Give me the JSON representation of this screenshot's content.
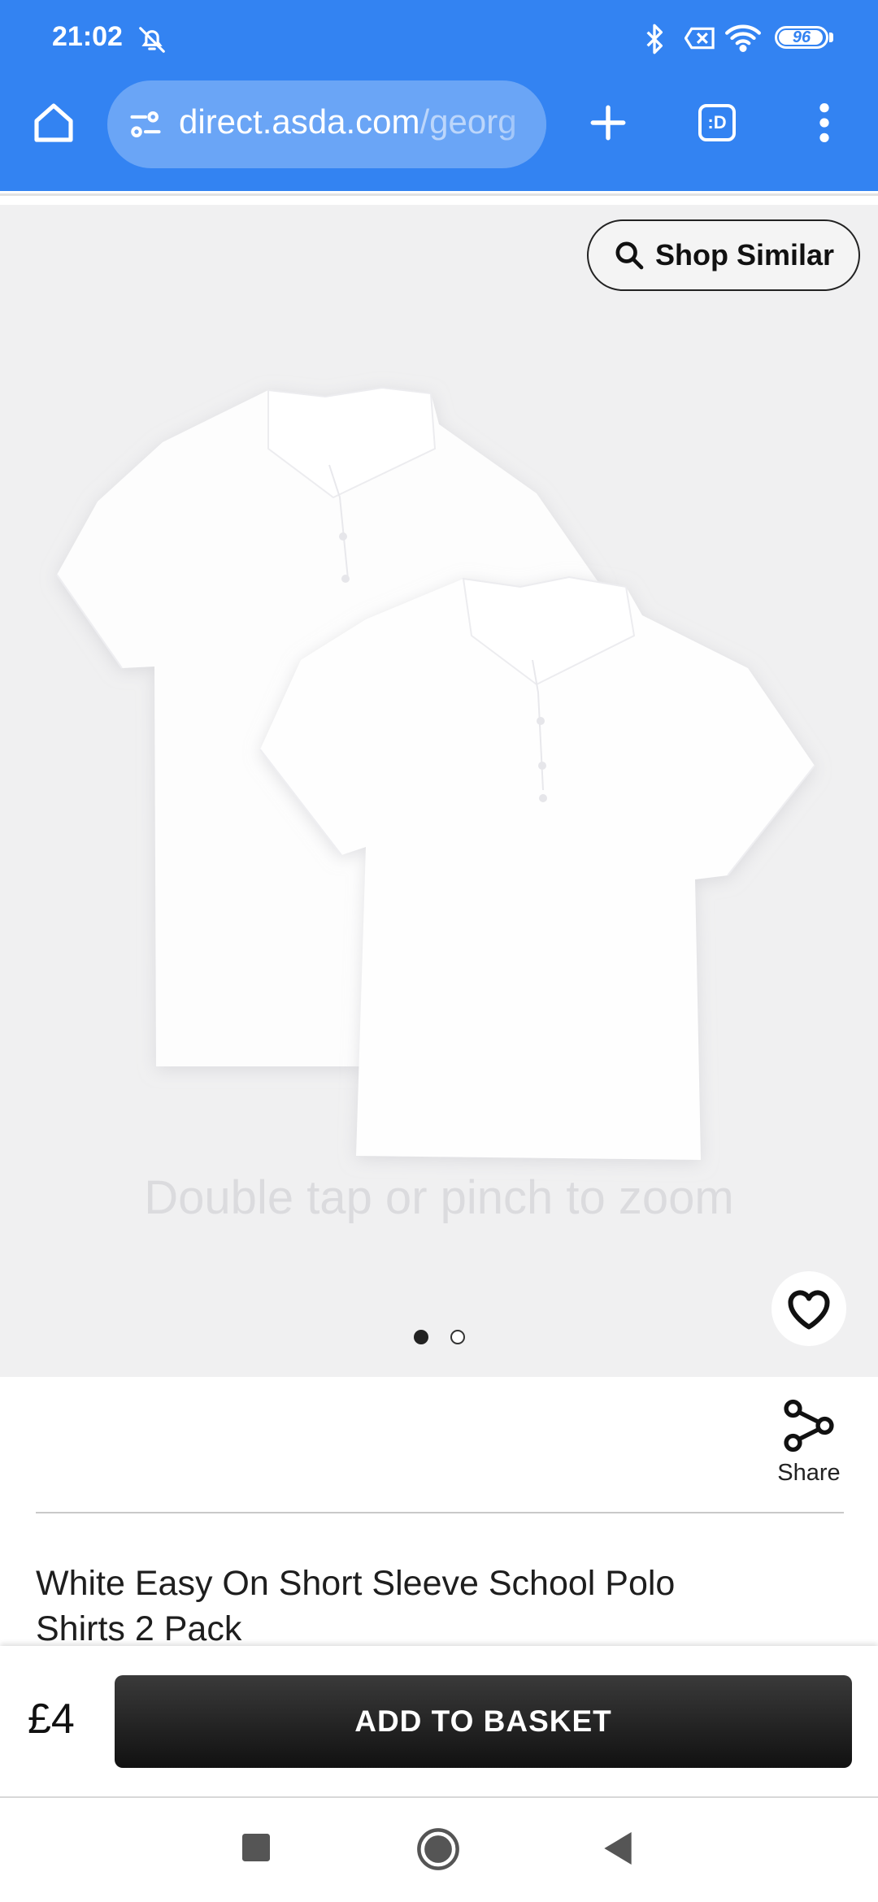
{
  "status_bar": {
    "time": "21:02",
    "battery_level": "96",
    "battery_fraction": 0.96,
    "icons": [
      "alarm-off-icon",
      "bluetooth-icon",
      "sim-disabled-icon",
      "wifi-icon",
      "battery-icon"
    ]
  },
  "browser": {
    "url_host": "direct.asda.com",
    "url_path": "/georg",
    "icons": [
      "home-icon",
      "site-settings-icon",
      "new-tab-icon",
      "tab-switcher-icon",
      "more-vert-icon"
    ],
    "tab_switcher_label": ":D",
    "theme_color": "#3383f2"
  },
  "gallery": {
    "shop_similar_label": "Shop Similar",
    "zoom_hint": "Double tap or pinch to zoom",
    "image_count": 2,
    "active_image": 1,
    "image_alt": ""
  },
  "product": {
    "share_label": "Share",
    "title": "White Easy On Short Sleeve School Polo Shirts 2 Pack",
    "price": "£4",
    "add_to_basket_label": "ADD TO BASKET"
  },
  "nav": {
    "icons": [
      "recents-square-icon",
      "home-circle-icon",
      "back-triangle-icon"
    ]
  }
}
